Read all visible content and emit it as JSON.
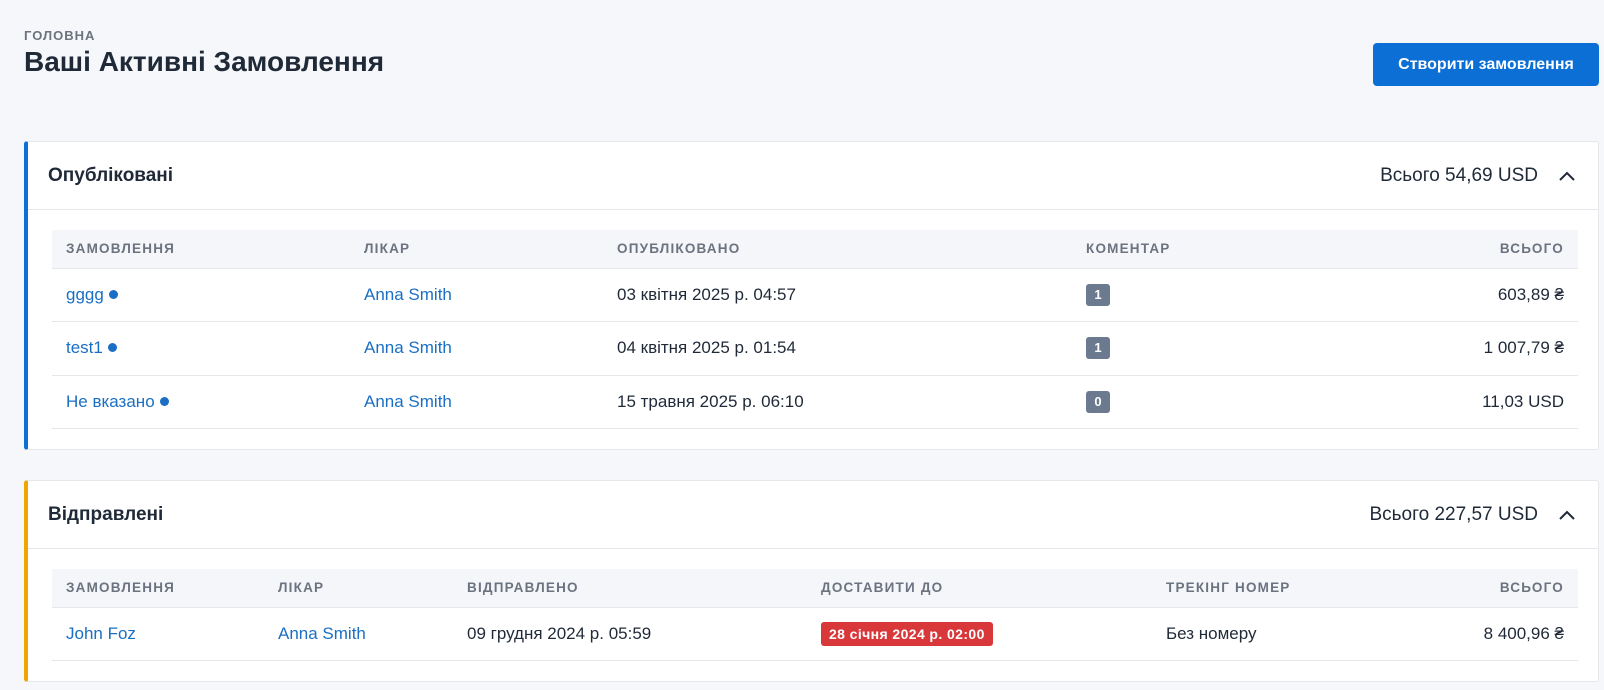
{
  "breadcrumb": "ГОЛОВНА",
  "page_title": "Ваші Активні Замовлення",
  "create_button": "Створити замовлення",
  "colors": {
    "accent": "#0b6fd6",
    "published_border": "#0b6fd6",
    "sent_border": "#f0a500",
    "overdue": "#d9383a",
    "badge": "#6b7a8f"
  },
  "published": {
    "title": "Опубліковані",
    "total": "Всього 54,69 USD",
    "collapse_icon": "chevron-up-icon",
    "columns": [
      "ЗАМОВЛЕННЯ",
      "ЛІКАР",
      "ОПУБЛІКОВАНО",
      "КОМЕНТАР",
      "ВСЬОГО"
    ],
    "rows": [
      {
        "order": "gggg",
        "doctor": "Anna Smith",
        "date": "03 квітня 2025 р. 04:57",
        "comments": "1",
        "total": "603,89 ₴"
      },
      {
        "order": "test1",
        "doctor": "Anna Smith",
        "date": "04 квітня 2025 р. 01:54",
        "comments": "1",
        "total": "1 007,79 ₴"
      },
      {
        "order": "Не вказано",
        "doctor": "Anna Smith",
        "date": "15 травня 2025 р. 06:10",
        "comments": "0",
        "total": "11,03 USD"
      }
    ]
  },
  "sent": {
    "title": "Відправлені",
    "total": "Всього 227,57 USD",
    "collapse_icon": "chevron-up-icon",
    "columns": [
      "ЗАМОВЛЕННЯ",
      "ЛІКАР",
      "ВІДПРАВЛЕНО",
      "ДОСТАВИТИ ДО",
      "ТРЕКІНГ НОМЕР",
      "ВСЬОГО"
    ],
    "rows": [
      {
        "order": "John Foz",
        "doctor": "Anna Smith",
        "sent_date": "09 грудня 2024 р. 05:59",
        "deliver_by": "28 січня 2024 р. 02:00",
        "tracking": "Без номеру",
        "total": "8 400,96 ₴"
      }
    ]
  }
}
